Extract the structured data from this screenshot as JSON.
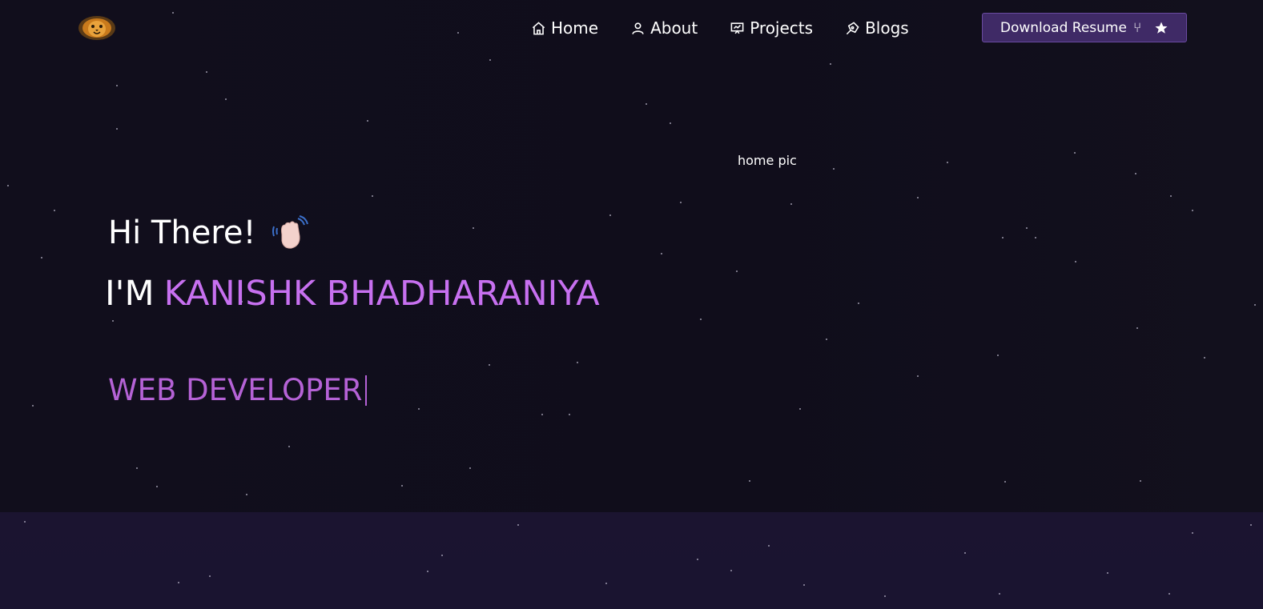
{
  "nav": {
    "items": [
      {
        "label": "Home",
        "icon": "home-icon"
      },
      {
        "label": "About",
        "icon": "user-icon"
      },
      {
        "label": "Projects",
        "icon": "presentation-icon"
      },
      {
        "label": "Blogs",
        "icon": "pen-nib-icon"
      }
    ],
    "resume_label": "Download Resume",
    "resume_icons": [
      "fork-icon",
      "star-icon"
    ]
  },
  "hero": {
    "image_alt": "home pic",
    "greeting": "Hi There!",
    "prefix": "I'M",
    "name": "KANISHK BHADHARANIYA",
    "role": "WEB DEVELOPER"
  },
  "colors": {
    "background": "#100d1c",
    "accent": "#c770f0",
    "button": "#3f2a66",
    "lower_section": "#1b1430"
  }
}
